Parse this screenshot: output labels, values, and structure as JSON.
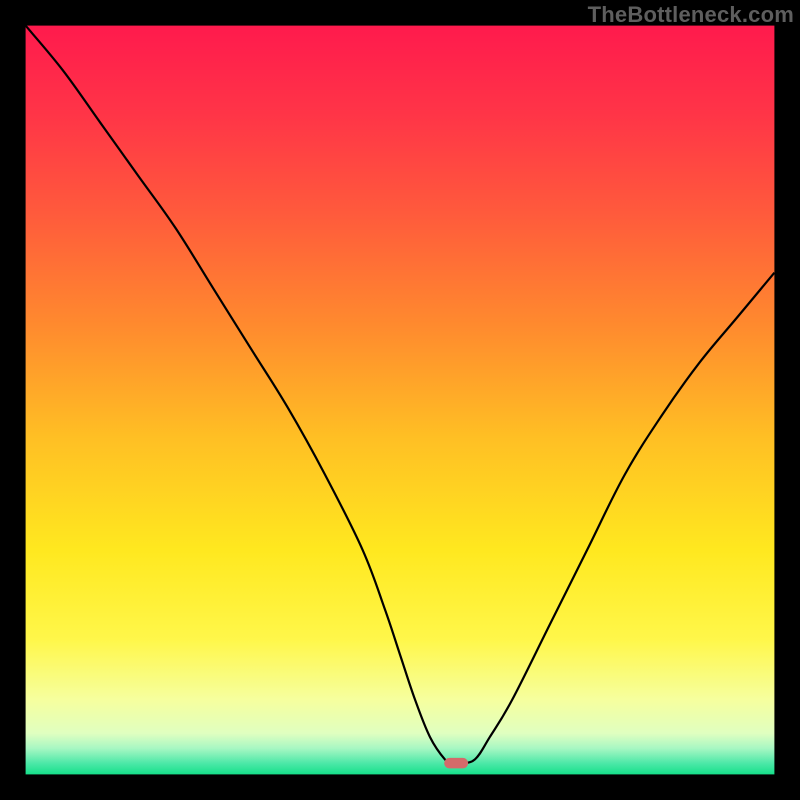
{
  "watermark": "TheBottleneck.com",
  "chart_data": {
    "type": "line",
    "title": "",
    "xlabel": "",
    "ylabel": "",
    "xlim": [
      0,
      100
    ],
    "ylim": [
      0,
      100
    ],
    "grid": false,
    "legend": false,
    "series": [
      {
        "name": "bottleneck-curve",
        "color": "#000000",
        "x": [
          0,
          5,
          10,
          15,
          20,
          25,
          30,
          35,
          40,
          45,
          48,
          50,
          52,
          54,
          56,
          57,
          58,
          60,
          62,
          65,
          70,
          75,
          80,
          85,
          90,
          95,
          100
        ],
        "values": [
          100,
          94,
          87,
          80,
          73,
          65,
          57,
          49,
          40,
          30,
          22,
          16,
          10,
          5,
          2,
          1.5,
          1.5,
          2,
          5,
          10,
          20,
          30,
          40,
          48,
          55,
          61,
          67
        ]
      }
    ],
    "marker": {
      "name": "optimal-marker",
      "x": 57.5,
      "y": 1.5,
      "color": "#d46a6a",
      "width": 3.2,
      "height": 1.4
    },
    "background": {
      "type": "vertical-gradient",
      "stops": [
        {
          "offset": 0.0,
          "color": "#ff1a4d"
        },
        {
          "offset": 0.12,
          "color": "#ff3547"
        },
        {
          "offset": 0.25,
          "color": "#ff5a3c"
        },
        {
          "offset": 0.4,
          "color": "#ff8a2e"
        },
        {
          "offset": 0.55,
          "color": "#ffbf24"
        },
        {
          "offset": 0.7,
          "color": "#ffe81f"
        },
        {
          "offset": 0.82,
          "color": "#fff74a"
        },
        {
          "offset": 0.9,
          "color": "#f6ff9e"
        },
        {
          "offset": 0.945,
          "color": "#e0ffc0"
        },
        {
          "offset": 0.965,
          "color": "#a8f7c3"
        },
        {
          "offset": 0.985,
          "color": "#4de8a8"
        },
        {
          "offset": 1.0,
          "color": "#16e08a"
        }
      ]
    },
    "plot_area_fraction": {
      "x0": 0.032,
      "y0": 0.032,
      "x1": 0.968,
      "y1": 0.968
    }
  }
}
